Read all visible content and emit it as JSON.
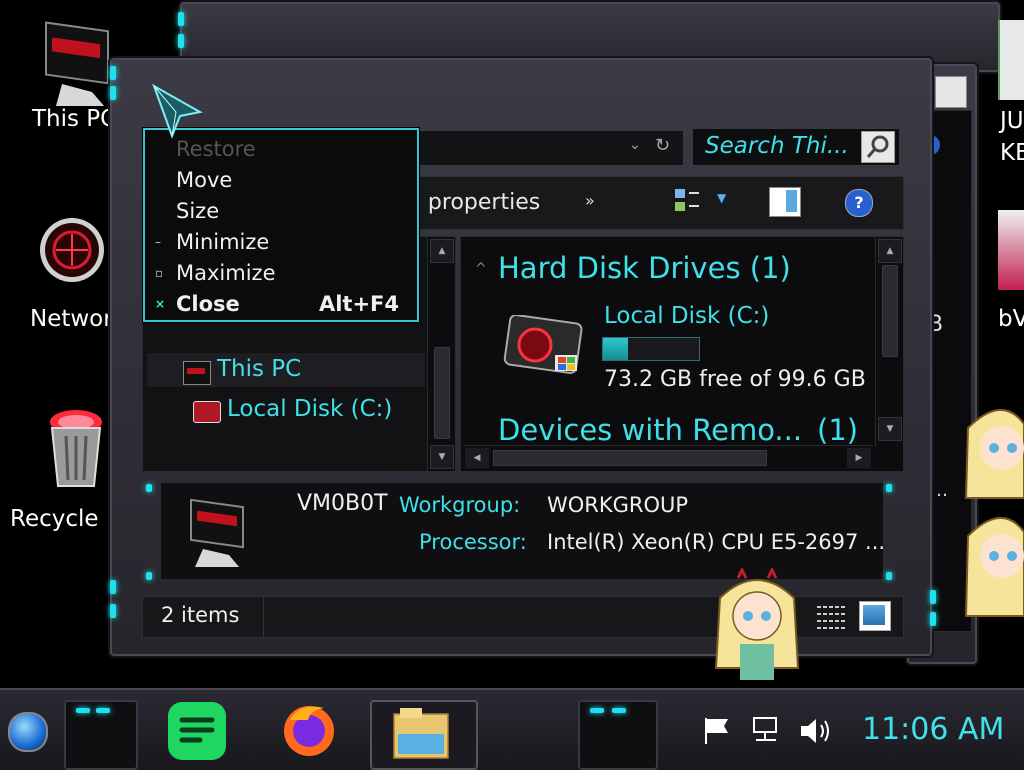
{
  "desktop": {
    "icons": [
      {
        "name": "this-pc",
        "label": "This PC"
      },
      {
        "name": "network",
        "label": "Networ"
      },
      {
        "name": "recycle-bin",
        "label": "Recycle B"
      }
    ],
    "right_labels": [
      "JU",
      "KE",
      "B",
      "bV"
    ]
  },
  "window": {
    "search_placeholder": "Search Thi...",
    "toolbar_properties": "n properties",
    "toolbar_more": "»",
    "hard_disk_heading": "Hard Disk Drives (1)",
    "devices_heading": "Devices with Remo...",
    "devices_count": "(1)",
    "local_disk_label": "Local Disk (C:)",
    "local_disk_free": "73.2 GB free of 99.6 GB",
    "local_disk_usage_fraction": 0.265,
    "nav_items": [
      {
        "label": "This PC",
        "icon": "computer-icon"
      },
      {
        "label": "Local Disk (C:)",
        "icon": "drive-icon"
      }
    ],
    "details": {
      "computer_name": "VM0B0T",
      "workgroup_label": "Workgroup:",
      "workgroup_value": "WORKGROUP",
      "processor_label": "Processor:",
      "processor_value": "Intel(R) Xeon(R) CPU E5-2697 ..."
    },
    "status_items": "2 items"
  },
  "context_menu": {
    "items": [
      {
        "label": "Restore",
        "mark": "",
        "accel": "",
        "enabled": false
      },
      {
        "label": "Move",
        "mark": "",
        "accel": "",
        "enabled": true
      },
      {
        "label": "Size",
        "mark": "",
        "accel": "",
        "enabled": true
      },
      {
        "label": "Minimize",
        "mark": "–",
        "accel": "",
        "enabled": true
      },
      {
        "label": "Maximize",
        "mark": "▫",
        "accel": "",
        "enabled": true
      },
      {
        "label": "Close",
        "mark": "×",
        "accel": "Alt+F4",
        "enabled": true
      }
    ]
  },
  "taskbar": {
    "clock": "11:06 AM",
    "apps": [
      "start-orb-icon",
      "spotify-like-app-icon",
      "firefox-icon",
      "file-explorer-icon"
    ],
    "tray": [
      "flag-icon",
      "network-icon",
      "volume-icon"
    ]
  },
  "colors": {
    "accent": "#3fe0e8",
    "menu_border": "#37c6cf",
    "progress": "#1fa9b0"
  }
}
